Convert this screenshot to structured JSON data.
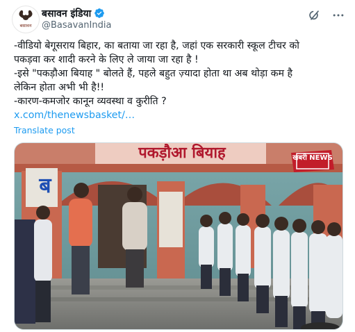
{
  "author": {
    "display_name": "बसावन इंडिया",
    "handle": "@BasavanIndia",
    "verified": true,
    "avatar_logo_text": "बसावन"
  },
  "tweet": {
    "lines": [
      "-वीडियो बेगूसराय बिहार, का बताया जा रहा है, जहां एक सरकारी स्कूल टीचर को",
      "पकड़वा कर शादी करने के लिए ले जाया जा रहा है !",
      "-इसे \"पकड़ौआ बियाह \" बोलते हैं, पहले बहुत ज़्यादा होता था अब थोड़ा कम है",
      "लेकिन होता अभी भी है!!",
      "-कारण-कमजोर कानून व्यवस्था व कुरीति ?"
    ],
    "link": "x.com/thenewsbasket/…",
    "translate_label": "Translate post"
  },
  "media": {
    "overlay_title": "पकड़ौआ बियाह",
    "channel_logo": "खबरी NEWS",
    "wall_sign": "ब"
  },
  "colors": {
    "accent": "#1d9bf0",
    "text": "#0f1419",
    "muted": "#536471",
    "overlay_title_color": "#b0182d"
  },
  "icons": {
    "verified": "verified-badge-icon",
    "grok": "grok-icon",
    "more": "more-icon"
  }
}
